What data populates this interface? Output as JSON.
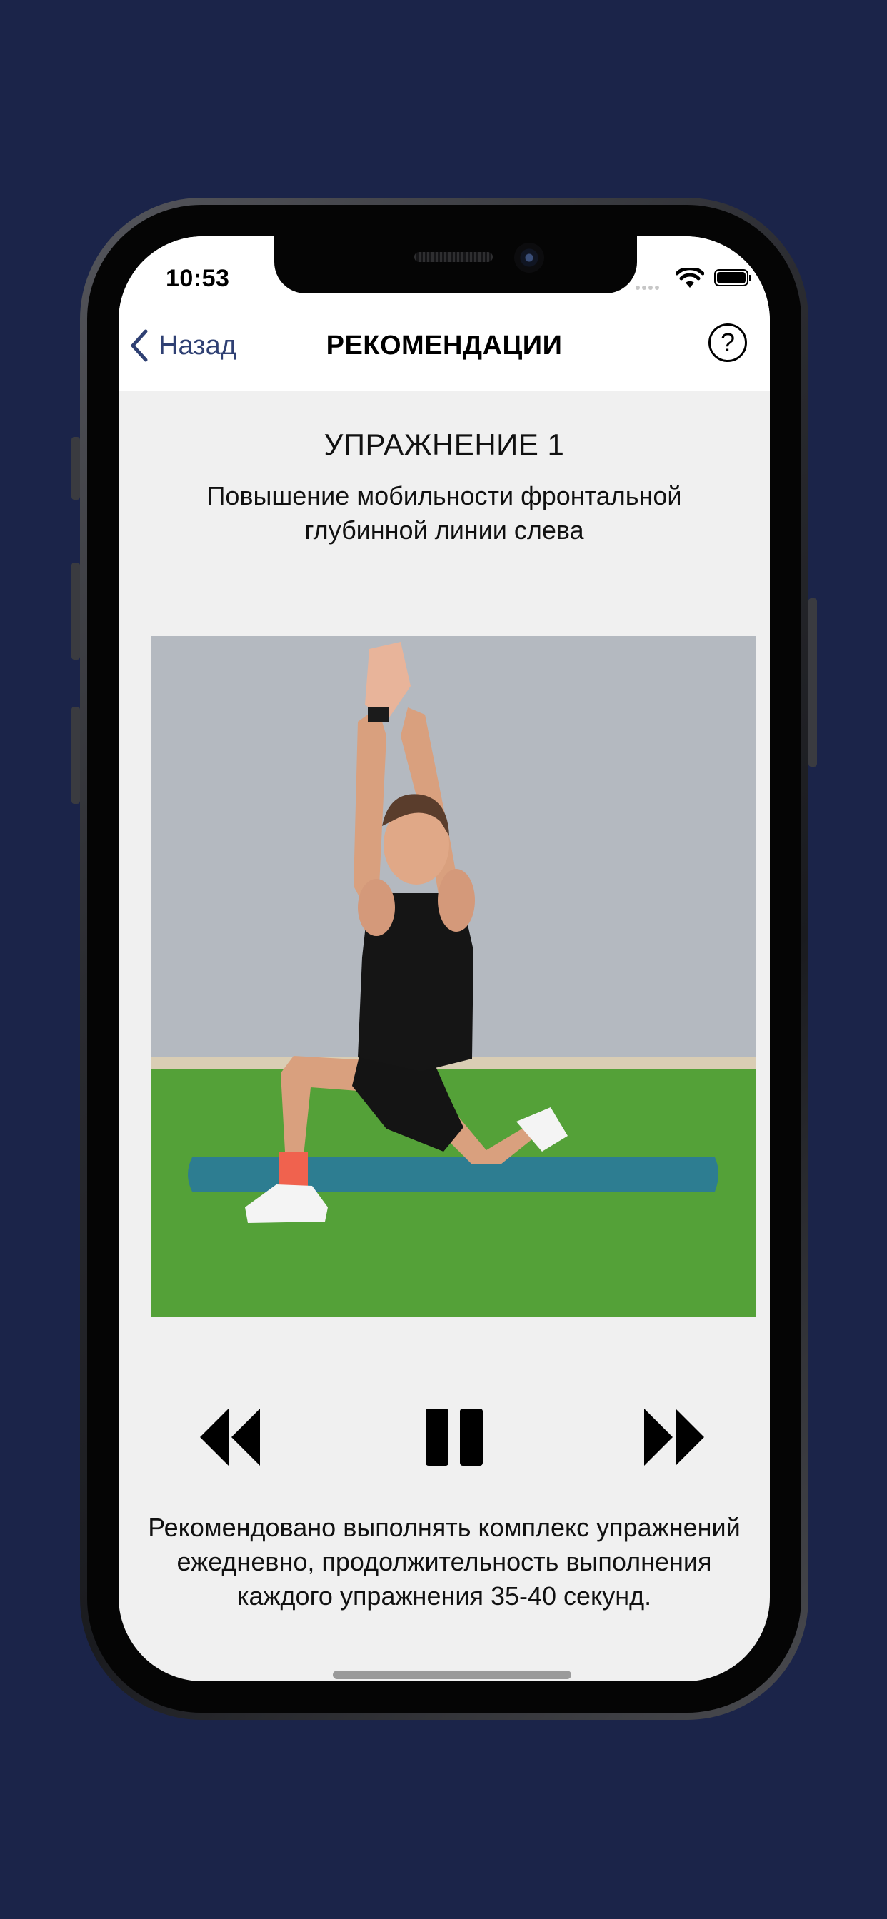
{
  "status_bar": {
    "time": "10:53"
  },
  "nav": {
    "back_label": "Назад",
    "title": "РЕКОМЕНДАЦИИ",
    "help_symbol": "?"
  },
  "exercise": {
    "title": "УПРАЖНЕНИЕ 1",
    "subtitle": "Повышение мобильности фронтальной глубинной линии слева"
  },
  "player": {
    "controls": [
      "rewind-icon",
      "pause-icon",
      "fast-forward-icon"
    ]
  },
  "description": "Рекомендовано выполнять комплекс упражнений ежедневно, продолжительность выполнения каждого упражнения 35-40 секунд.",
  "colors": {
    "background": "#1b2449",
    "accent": "#2f4073",
    "screen": "#f0f0f0"
  }
}
